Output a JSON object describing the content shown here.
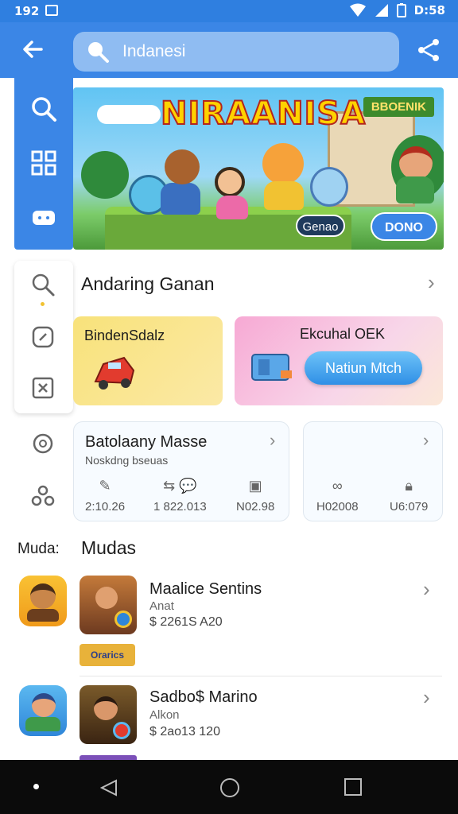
{
  "status_bar": {
    "time": "192",
    "clock": "D:58"
  },
  "app_bar": {
    "search_text": "Indanesi"
  },
  "banner": {
    "title": "NIRAANISA",
    "badge": "BBOENIK",
    "pill_dark": "Genao",
    "pill_blue": "DONO"
  },
  "section": {
    "title": "Andaring Ganan"
  },
  "cards": {
    "yellow_label": "BindenSdalz",
    "pink_label": "Ekcuhal OEK",
    "pink_button": "Natiun Mtch"
  },
  "stats": {
    "title": "Batolaany Masse",
    "subtitle": "Noskdng bseuas",
    "items": [
      "2:10.26",
      "1 822.013",
      "N02.98",
      "H02008",
      "U6:079"
    ]
  },
  "mudas": {
    "left_label": "Muda:",
    "title": "Mudas",
    "apps": [
      {
        "name": "Maalice Sentins",
        "sub": "Anat",
        "price": "$ 2261S A20",
        "thumb_banner": "Orarics"
      },
      {
        "name": "Sadbo$ Marino",
        "sub": "Alkon",
        "price": "$ 2ao13 120"
      }
    ]
  },
  "colors": {
    "primary": "#3b86e6",
    "status": "#2f7fe0",
    "nav": "#0b0b0b"
  }
}
